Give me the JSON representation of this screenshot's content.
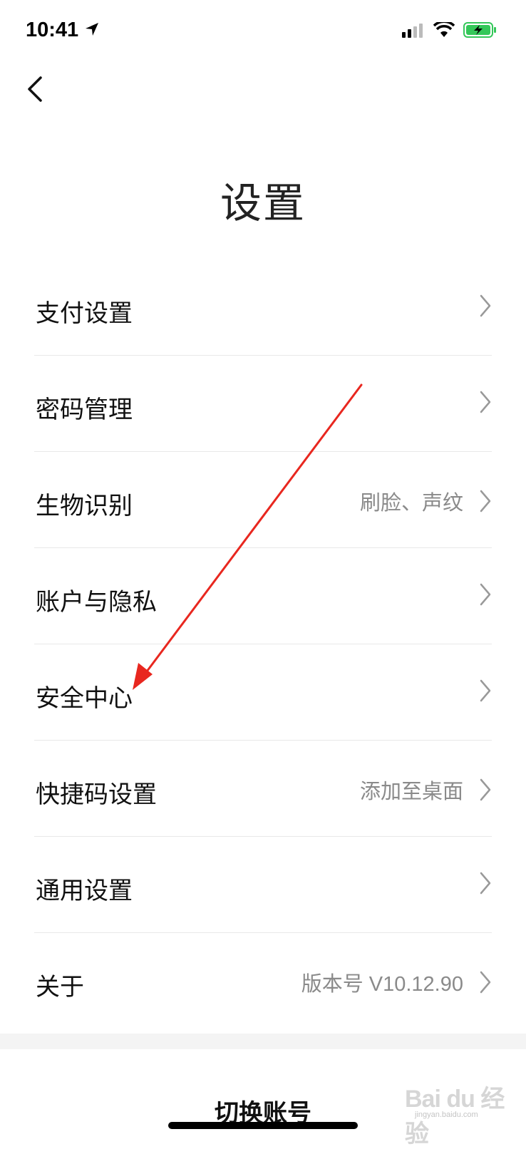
{
  "status_bar": {
    "time": "10:41",
    "icons": [
      "location-arrow-icon",
      "signal-icon",
      "wifi-icon",
      "battery-charging-icon"
    ],
    "battery_color": "#34c759"
  },
  "nav": {
    "back_icon": "chevron-left-icon"
  },
  "page": {
    "title": "设置"
  },
  "settings": {
    "items": [
      {
        "label": "支付设置",
        "value": ""
      },
      {
        "label": "密码管理",
        "value": ""
      },
      {
        "label": "生物识别",
        "value": "刷脸、声纹"
      },
      {
        "label": "账户与隐私",
        "value": ""
      },
      {
        "label": "安全中心",
        "value": ""
      },
      {
        "label": "快捷码设置",
        "value": "添加至桌面"
      },
      {
        "label": "通用设置",
        "value": ""
      },
      {
        "label": "关于",
        "value": "版本号 V10.12.90"
      }
    ]
  },
  "footer": {
    "switch_account": "切换账号"
  },
  "watermark": {
    "text": "Bai du 经验",
    "sub": "jingyan.baidu.com"
  },
  "annotation": {
    "arrow_color": "#e8271f",
    "points_to": "安全中心"
  }
}
